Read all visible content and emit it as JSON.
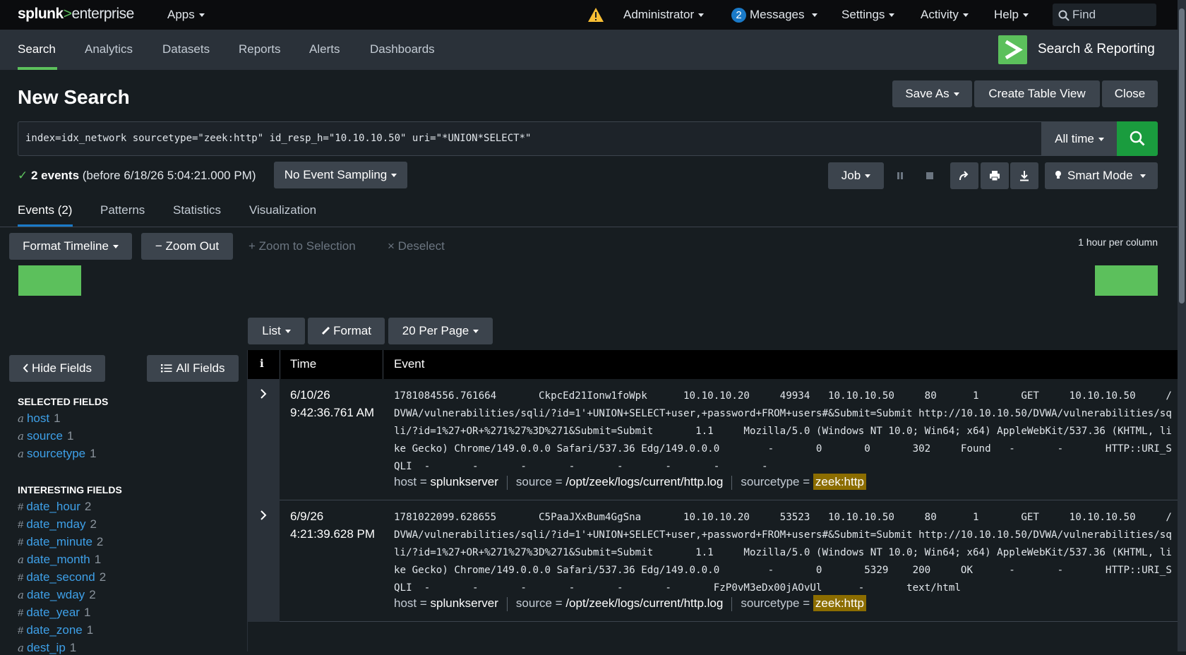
{
  "topbar": {
    "logo_splunk": "splunk",
    "logo_gt": ">",
    "logo_enterprise": "enterprise",
    "apps": "Apps",
    "administrator": "Administrator",
    "messages_count": "2",
    "messages": "Messages",
    "settings": "Settings",
    "activity": "Activity",
    "help": "Help",
    "find_placeholder": "Find"
  },
  "appbar": {
    "tabs": [
      "Search",
      "Analytics",
      "Datasets",
      "Reports",
      "Alerts",
      "Dashboards"
    ],
    "app_name": "Search & Reporting"
  },
  "page": {
    "title": "New Search",
    "save_as": "Save As",
    "create_table_view": "Create Table View",
    "close": "Close"
  },
  "search": {
    "query": "index=idx_network sourcetype=\"zeek:http\" id_resp_h=\"10.10.10.50\" uri=\"*UNION*SELECT*\"",
    "time_range": "All time"
  },
  "status": {
    "check": "✓",
    "events": "2 events",
    "before": "(before 6/18/26 5:04:21.000 PM)",
    "sampling": "No Event Sampling",
    "job": "Job",
    "smart_mode": "Smart Mode"
  },
  "result_tabs": [
    "Events (2)",
    "Patterns",
    "Statistics",
    "Visualization"
  ],
  "timeline": {
    "format_timeline": "Format Timeline",
    "zoom_out": "− Zoom Out",
    "zoom_to_selection": "+ Zoom to Selection",
    "deselect": "× Deselect",
    "per_column": "1 hour per column",
    "color": "#5cc05c"
  },
  "list_controls": {
    "list": "List",
    "format": "Format",
    "per_page": "20 Per Page"
  },
  "sidebar": {
    "hide_fields": "Hide Fields",
    "all_fields": "All Fields",
    "selected_heading": "SELECTED FIELDS",
    "selected": [
      {
        "type": "a",
        "name": "host",
        "count": "1"
      },
      {
        "type": "a",
        "name": "source",
        "count": "1"
      },
      {
        "type": "a",
        "name": "sourcetype",
        "count": "1"
      }
    ],
    "interesting_heading": "INTERESTING FIELDS",
    "interesting": [
      {
        "type": "#",
        "name": "date_hour",
        "count": "2"
      },
      {
        "type": "#",
        "name": "date_mday",
        "count": "2"
      },
      {
        "type": "#",
        "name": "date_minute",
        "count": "2"
      },
      {
        "type": "a",
        "name": "date_month",
        "count": "1"
      },
      {
        "type": "#",
        "name": "date_second",
        "count": "2"
      },
      {
        "type": "a",
        "name": "date_wday",
        "count": "2"
      },
      {
        "type": "#",
        "name": "date_year",
        "count": "1"
      },
      {
        "type": "#",
        "name": "date_zone",
        "count": "1"
      },
      {
        "type": "a",
        "name": "dest_ip",
        "count": "1"
      }
    ]
  },
  "table": {
    "col_info": "i",
    "col_time": "Time",
    "col_event": "Event",
    "rows": [
      {
        "date": "6/10/26",
        "time": "9:42:36.761 AM",
        "event": "1781084556.761664       CkpcEd21Ionw1foWpk      10.10.10.20     49934   10.10.10.50     80      1       GET     10.10.10.50     /DVWA/vulnerabilities/sqli/?id=1'+UNION+SELECT+user,+password+FROM+users#&Submit=Submit http://10.10.10.50/DVWA/vulnerabilities/sqli/?id=1%27+OR+%271%27%3D%271&Submit=Submit       1.1     Mozilla/5.0 (Windows NT 10.0; Win64; x64) AppleWebKit/537.36 (KHTML, like Gecko) Chrome/149.0.0.0 Safari/537.36 Edg/149.0.0.0        -       0       0       302     Found   -       -       HTTP::URI_SQLI  -       -       -       -       -       -       -       -",
        "host_label": "host =",
        "host": "splunkserver",
        "source_label": "source =",
        "source": "/opt/zeek/logs/current/http.log",
        "sourcetype_label": "sourcetype =",
        "sourcetype": "zeek:http"
      },
      {
        "date": "6/9/26",
        "time": "4:21:39.628 PM",
        "event": "1781022099.628655       C5PaaJXxBum4GgSna       10.10.10.20     53523   10.10.10.50     80      1       GET     10.10.10.50     /DVWA/vulnerabilities/sqli/?id=1'+UNION+SELECT+user,+password+FROM+users#&Submit=Submit http://10.10.10.50/DVWA/vulnerabilities/sqli/?id=1%27+OR+%271%27%3D%271&Submit=Submit       1.1     Mozilla/5.0 (Windows NT 10.0; Win64; x64) AppleWebKit/537.36 (KHTML, like Gecko) Chrome/149.0.0.0 Safari/537.36 Edg/149.0.0.0        -       0       5329    200     OK      -       -       HTTP::URI_SQLI  -       -       -       -       -       -       FzP0vM3eDx00jAOvUl      -       text/html",
        "host_label": "host =",
        "host": "splunkserver",
        "source_label": "source =",
        "source": "/opt/zeek/logs/current/http.log",
        "sourcetype_label": "sourcetype =",
        "sourcetype": "zeek:http"
      }
    ]
  },
  "colors": {
    "accent_green": "#5cc05c",
    "search_green": "#1a9c3e",
    "link_blue": "#3ea0e8",
    "highlight": "#8c6d00"
  }
}
